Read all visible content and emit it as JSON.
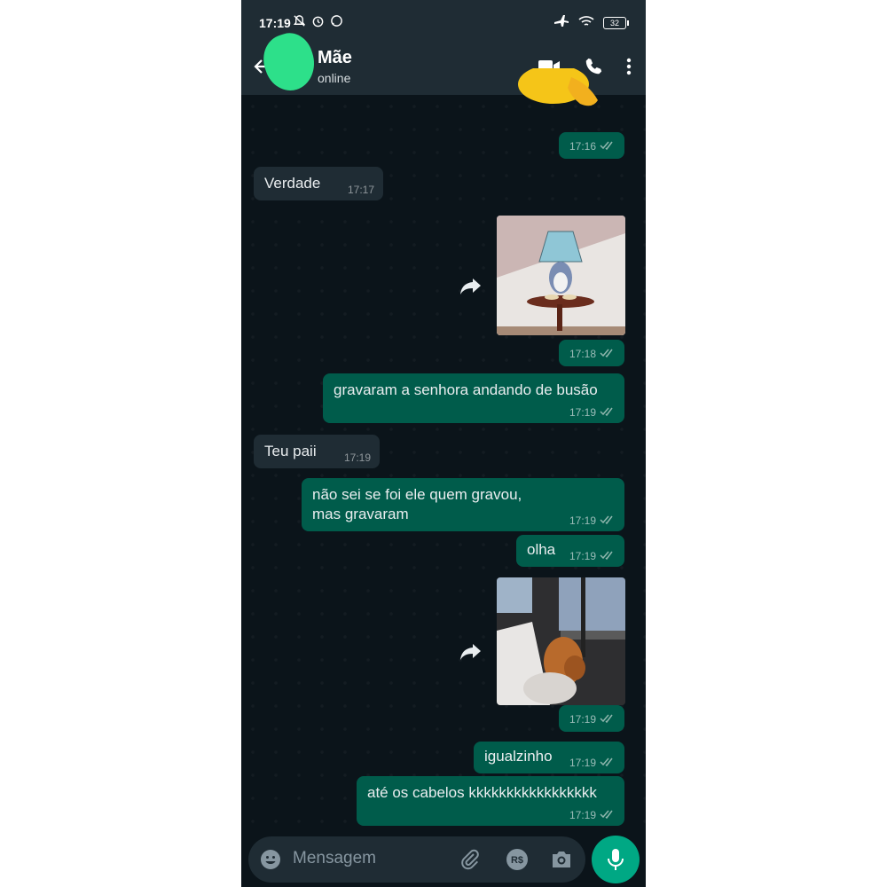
{
  "status_bar": {
    "time": "17:19",
    "battery": "32"
  },
  "header": {
    "contact_name": "Mãe",
    "contact_status": "online"
  },
  "messages": [
    {
      "dir": "out",
      "type": "sticker",
      "time": "17:16"
    },
    {
      "dir": "in",
      "type": "text",
      "text": "Verdade",
      "time": "17:17"
    },
    {
      "dir": "out",
      "type": "gif",
      "time": "17:18"
    },
    {
      "dir": "out",
      "type": "text",
      "text": "gravaram a senhora andando de busão",
      "time": "17:19"
    },
    {
      "dir": "in",
      "type": "text",
      "text": "Teu paii",
      "time": "17:19"
    },
    {
      "dir": "out",
      "type": "text",
      "text": "não sei se foi ele quem gravou, mas gravaram",
      "time": "17:19"
    },
    {
      "dir": "out",
      "type": "text",
      "text": "olha",
      "time": "17:19"
    },
    {
      "dir": "out",
      "type": "gif",
      "time": "17:19"
    },
    {
      "dir": "out",
      "type": "text",
      "text": "igualzinho",
      "time": "17:19"
    },
    {
      "dir": "out",
      "type": "text",
      "text": "até os cabelos kkkkkkkkkkkkkkkkk",
      "time": "17:19"
    }
  ],
  "composer": {
    "placeholder": "Mensagem"
  },
  "icons": {
    "back": "arrow-left-icon",
    "video": "video-call-icon",
    "call": "phone-icon",
    "menu": "more-vert-icon",
    "emoji": "emoji-icon",
    "attach": "paperclip-icon",
    "payment": "payment-icon",
    "camera": "camera-icon",
    "mic": "microphone-icon",
    "forward": "forward-icon"
  },
  "colors": {
    "header_bg": "#1f2c34",
    "chat_bg": "#0b141a",
    "outgoing_bubble": "#005c4b",
    "incoming_bubble": "#1f2c34",
    "accent": "#00a884",
    "read_ticks": "#8fb6ad"
  }
}
